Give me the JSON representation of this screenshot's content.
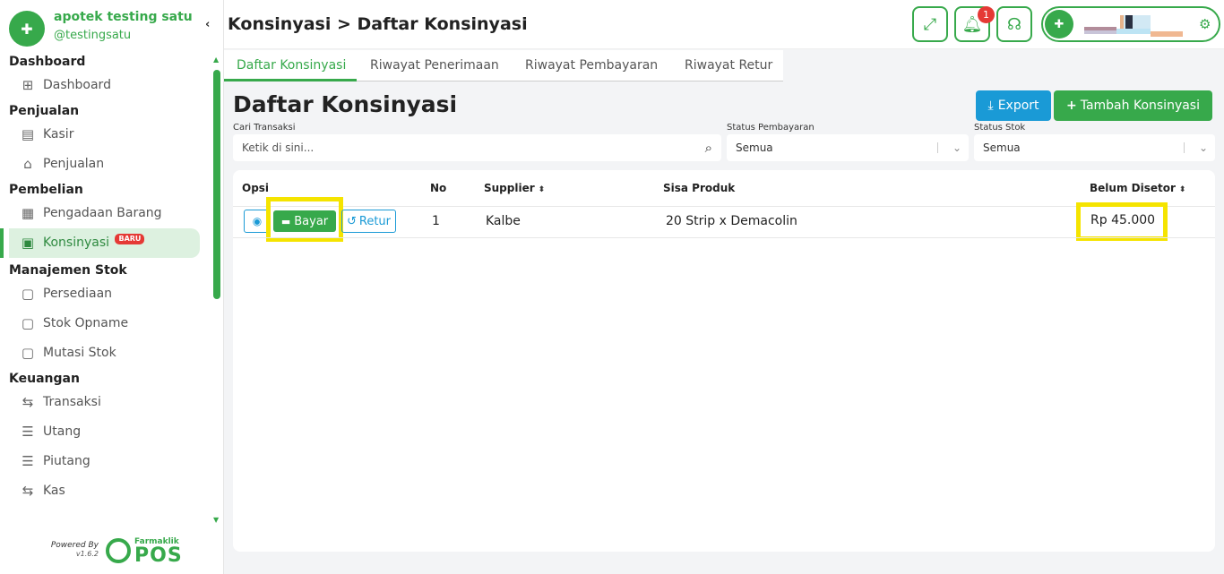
{
  "brand": {
    "name": "apotek testing satu",
    "handle": "@testingsatu"
  },
  "sidebar": {
    "collapse_icon": "chevron-left-icon",
    "sections": [
      {
        "title": "Dashboard",
        "items": [
          {
            "label": "Dashboard",
            "icon": "grid-icon"
          }
        ]
      },
      {
        "title": "Penjualan",
        "items": [
          {
            "label": "Kasir",
            "icon": "cash-register-icon"
          },
          {
            "label": "Penjualan",
            "icon": "basket-icon"
          }
        ]
      },
      {
        "title": "Pembelian",
        "items": [
          {
            "label": "Pengadaan Barang",
            "icon": "procurement-icon"
          },
          {
            "label": "Konsinyasi",
            "icon": "box-icon",
            "active": true,
            "badge": "BARU"
          }
        ]
      },
      {
        "title": "Manajemen Stok",
        "items": [
          {
            "label": "Persediaan",
            "icon": "inventory-icon"
          },
          {
            "label": "Stok Opname",
            "icon": "stock-opname-icon"
          },
          {
            "label": "Mutasi Stok",
            "icon": "stock-mutation-icon"
          }
        ]
      },
      {
        "title": "Keuangan",
        "items": [
          {
            "label": "Transaksi",
            "icon": "transfer-icon"
          },
          {
            "label": "Utang",
            "icon": "ledger-icon"
          },
          {
            "label": "Piutang",
            "icon": "ledger-icon"
          },
          {
            "label": "Kas",
            "icon": "transfer-icon"
          }
        ]
      }
    ],
    "footer": {
      "powered_by": "Powered By",
      "version": "v1.6.2",
      "logo_small": "Farmaklik",
      "logo_big": "POS"
    }
  },
  "header": {
    "breadcrumb": "Konsinyasi > Daftar Konsinyasi",
    "notification_count": "1",
    "buttons": [
      "fullscreen-icon",
      "bell-icon",
      "headset-icon"
    ]
  },
  "tabs": [
    {
      "label": "Daftar Konsinyasi",
      "active": true
    },
    {
      "label": "Riwayat Penerimaan"
    },
    {
      "label": "Riwayat Pembayaran"
    },
    {
      "label": "Riwayat Retur"
    }
  ],
  "main": {
    "title": "Daftar Konsinyasi",
    "export_label": "Export",
    "add_label": "Tambah Konsinyasi",
    "filters": {
      "search_label": "Cari Transaksi",
      "search_placeholder": "Ketik di sini...",
      "payment_status_label": "Status Pembayaran",
      "payment_status_value": "Semua",
      "stock_status_label": "Status Stok",
      "stock_status_value": "Semua"
    },
    "table": {
      "headers": {
        "opsi": "Opsi",
        "no": "No",
        "supplier": "Supplier",
        "sisa_produk": "Sisa Produk",
        "belum_disetor": "Belum Disetor"
      },
      "rows": [
        {
          "no": "1",
          "supplier": "Kalbe",
          "sisa_produk": "20 Strip x Demacolin",
          "belum_disetor": "Rp 45.000",
          "bayar_label": "Bayar",
          "retur_label": "Retur"
        }
      ]
    }
  },
  "colors": {
    "primary": "#37a94b",
    "info": "#1a9ad6",
    "danger": "#e53935",
    "highlight": "#f5e400"
  }
}
